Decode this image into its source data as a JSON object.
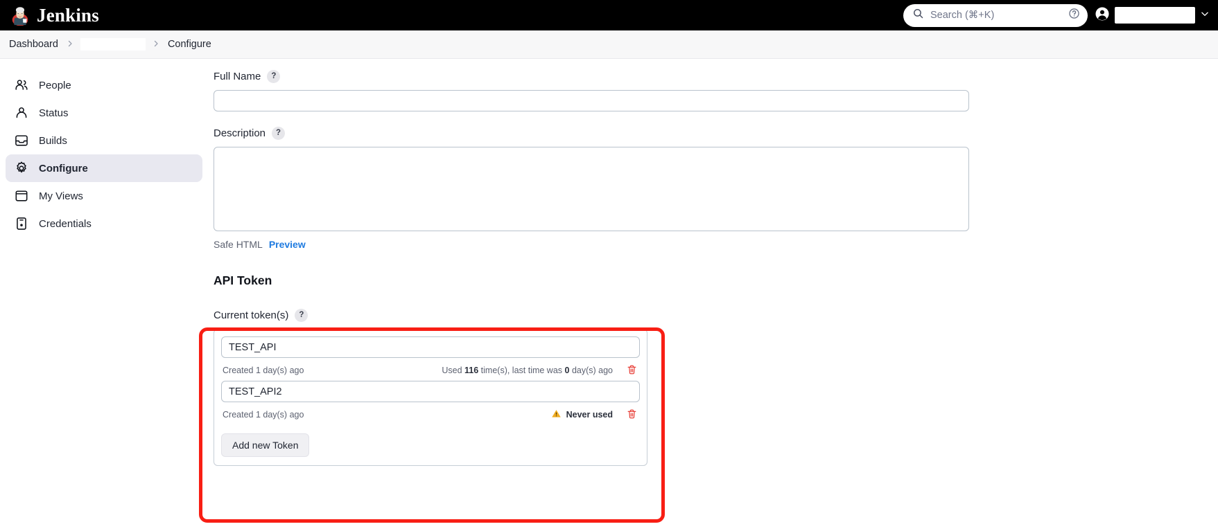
{
  "appbar": {
    "brand": "Jenkins",
    "logo_icon": "jenkins-butler-logo",
    "search": {
      "placeholder": "Search (⌘+K)",
      "value": "",
      "icon": "search-icon",
      "help_icon": "question-circle-icon"
    },
    "user": {
      "avatar_icon": "user-circle-icon",
      "name": "",
      "caret_icon": "chevron-down-icon"
    }
  },
  "breadcrumb": {
    "items": [
      {
        "label": "Dashboard",
        "redacted": false
      },
      {
        "label": "",
        "redacted": true
      },
      {
        "label": "Configure",
        "redacted": false
      }
    ],
    "separator": "›"
  },
  "sidebar": {
    "items": [
      {
        "label": "People",
        "icon": "people-icon",
        "active": false
      },
      {
        "label": "Status",
        "icon": "person-icon",
        "active": false
      },
      {
        "label": "Builds",
        "icon": "inbox-icon",
        "active": false
      },
      {
        "label": "Configure",
        "icon": "gear-icon",
        "active": true
      },
      {
        "label": "My Views",
        "icon": "window-icon",
        "active": false
      },
      {
        "label": "Credentials",
        "icon": "credential-card-icon",
        "active": false
      }
    ]
  },
  "main": {
    "full_name": {
      "label": "Full Name",
      "help": "?",
      "value": "",
      "placeholder": ""
    },
    "description": {
      "label": "Description",
      "help": "?",
      "value": "",
      "placeholder": ""
    },
    "safe_html": {
      "label": "Safe HTML",
      "preview_link": "Preview"
    },
    "api_token": {
      "title": "API Token",
      "current_tokens_label": "Current token(s)",
      "current_tokens_help": "?",
      "tokens": [
        {
          "name": "TEST_API",
          "created": "Created 1 day(s) ago",
          "usage_prefix": "Used ",
          "usage_count": "116",
          "usage_middle": " time(s), last time was ",
          "usage_days": "0",
          "usage_suffix": " day(s) ago",
          "never_used": "",
          "never_used_icon": "",
          "delete_icon": "trash-icon"
        },
        {
          "name": "TEST_API2",
          "created": "Created 1 day(s) ago",
          "usage_prefix": "",
          "usage_count": "",
          "usage_middle": "",
          "usage_days": "",
          "usage_suffix": "",
          "never_used": "Never used",
          "never_used_icon": "warning-triangle-icon",
          "delete_icon": "trash-icon"
        }
      ],
      "add_button": "Add new Token"
    }
  },
  "colors": {
    "annotation": "#f81e14",
    "link": "#1f7be0",
    "sidebar_active_bg": "#e8e8f0",
    "appbar_bg": "#000000",
    "warning": "#f0ad22",
    "trash": "#e8413a"
  }
}
